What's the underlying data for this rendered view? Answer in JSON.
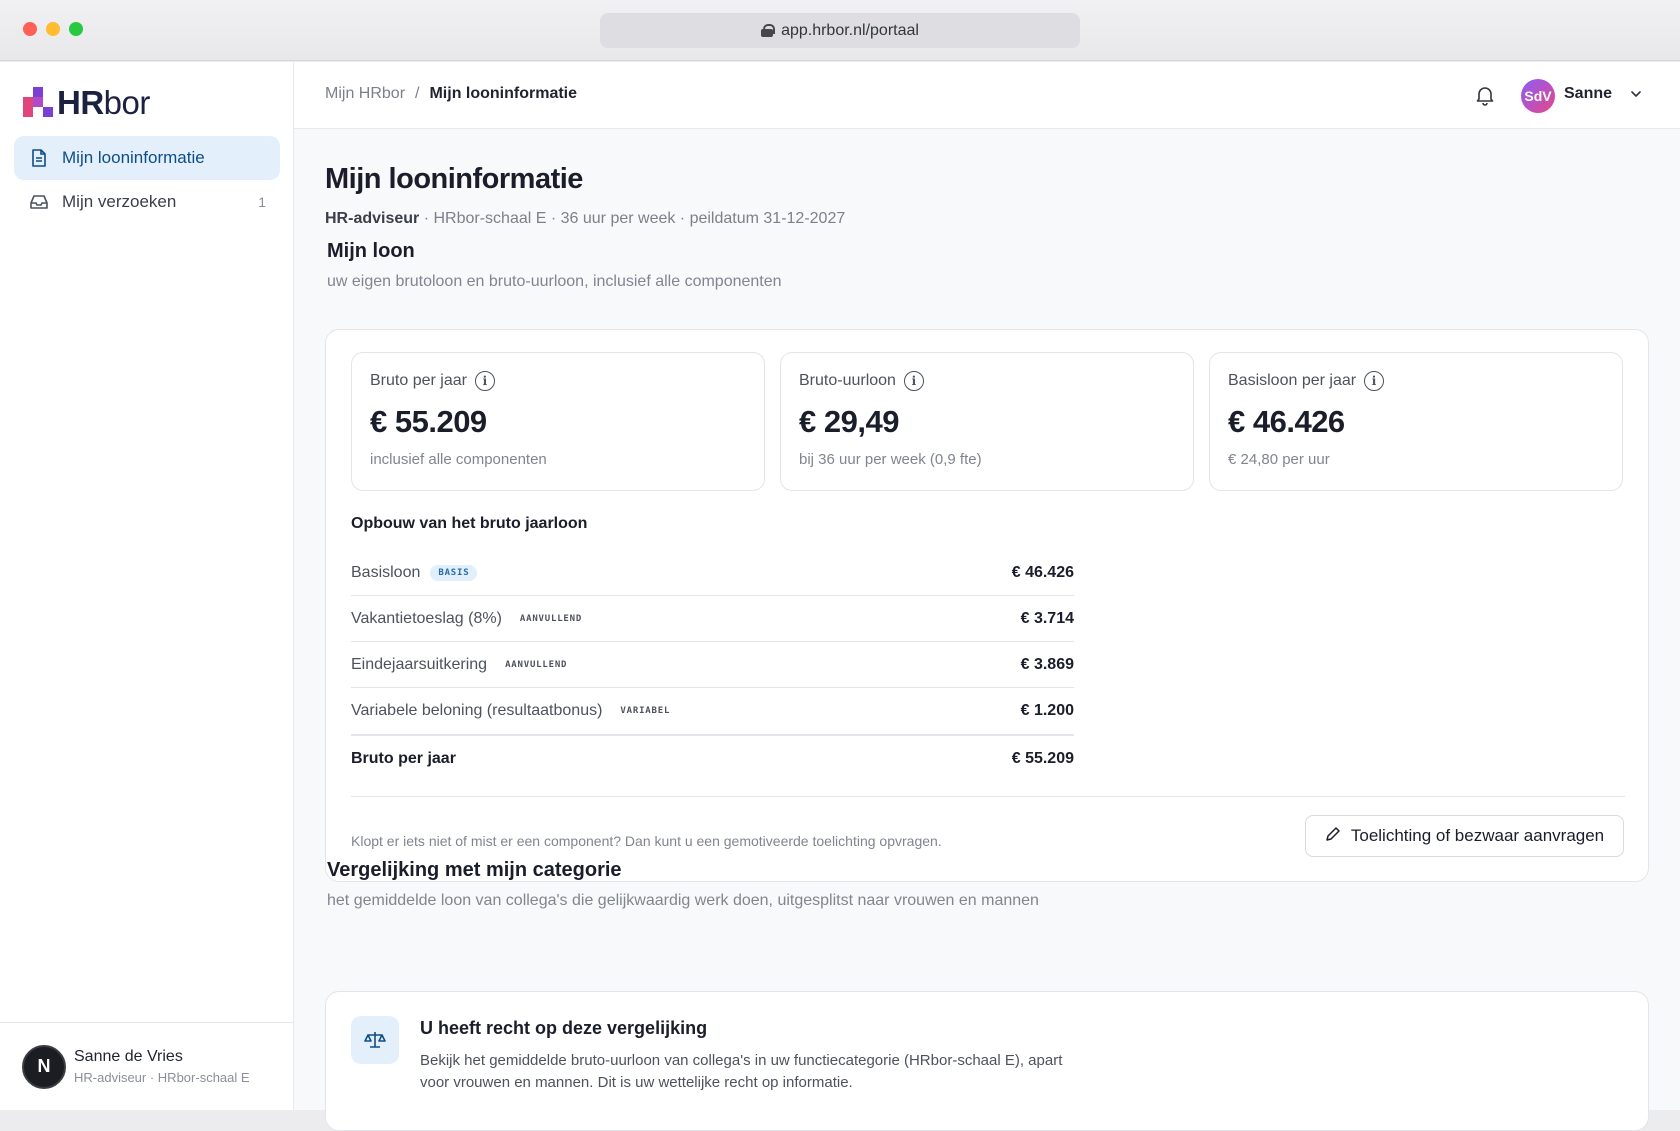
{
  "browser": {
    "url": "app.hrbor.nl/portaal"
  },
  "brand": {
    "name_strong": "HR",
    "name_rest": "bor"
  },
  "sidebar": {
    "items": [
      {
        "label": "Mijn looninformatie",
        "active": true
      },
      {
        "label": "Mijn verzoeken",
        "count": "1"
      }
    ],
    "user": {
      "initial": "N",
      "name": "Sanne de Vries",
      "role": "HR-adviseur · HRbor-schaal E"
    }
  },
  "topbar": {
    "breadcrumb": {
      "root": "Mijn HRbor",
      "separator": "/",
      "current": "Mijn looninformatie"
    },
    "avatar_initials": "SdV",
    "user_name": "Sanne"
  },
  "page": {
    "title": "Mijn looninformatie",
    "role": "HR-adviseur",
    "meta": "· HRbor-schaal E · 36 uur per week · peildatum 31-12-2027"
  },
  "loon": {
    "title": "Mijn loon",
    "subtitle": "uw eigen brutoloon en bruto-uurloon, inclusief alle componenten",
    "stats": [
      {
        "label": "Bruto per jaar",
        "value": "€ 55.209",
        "note": "inclusief alle componenten"
      },
      {
        "label": "Bruto-uurloon",
        "value": "€ 29,49",
        "note": "bij 36 uur per week (0,9 fte)"
      },
      {
        "label": "Basisloon per jaar",
        "value": "€ 46.426",
        "note": "€ 24,80 per uur"
      }
    ],
    "breakdown_title": "Opbouw van het bruto jaarloon",
    "rows": [
      {
        "label": "Basisloon",
        "badge": "BASIS",
        "value": "€ 46.426"
      },
      {
        "label": "Vakantietoeslag (8%)",
        "badge": "AANVULLEND",
        "value": "€ 3.714"
      },
      {
        "label": "Eindejaarsuitkering",
        "badge": "AANVULLEND",
        "value": "€ 3.869"
      },
      {
        "label": "Variabele beloning (resultaatbonus)",
        "badge": "VARIABEL",
        "value": "€ 1.200"
      }
    ],
    "total": {
      "label": "Bruto per jaar",
      "value": "€ 55.209"
    },
    "hint": "Klopt er iets niet of mist er een component? Dan kunt u een gemotiveerde toelichting opvragen.",
    "action_label": "Toelichting of bezwaar aanvragen"
  },
  "vergelijking": {
    "title": "Vergelijking met mijn categorie",
    "subtitle": "het gemiddelde loon van collega's die gelijkwaardig werk doen, uitgesplitst naar vrouwen en mannen",
    "card_title": "U heeft recht op deze vergelijking",
    "card_text": "Bekijk het gemiddelde bruto-uurloon van collega's in uw functiecategorie (HRbor-schaal E), apart voor vrouwen en mannen. Dit is uw wettelijke recht op informatie."
  },
  "colors": {
    "accent": "#0f4d86",
    "active_bg": "#e3f0fc",
    "logo_pink": "#e0457b",
    "logo_purple": "#7b3fd1"
  }
}
